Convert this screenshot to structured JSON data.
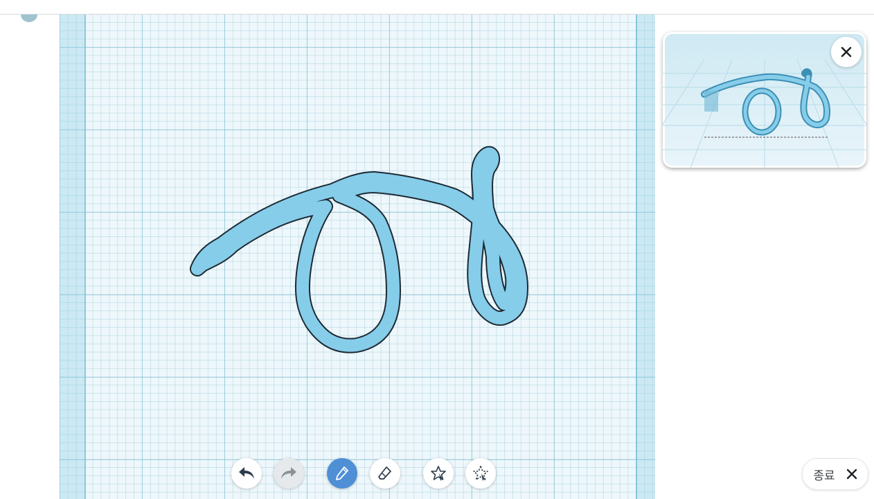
{
  "exit_button": {
    "label": "종료"
  },
  "colors": {
    "stroke_fill": "#86cde9",
    "stroke_outline": "#1c2a35",
    "active_tool": "#4e8fd6",
    "canvas_bg": "#eef7fb"
  },
  "toolbar": {
    "tools": [
      {
        "name": "undo",
        "icon": "undo-icon",
        "state": "enabled"
      },
      {
        "name": "redo",
        "icon": "redo-icon",
        "state": "disabled"
      },
      {
        "name": "pencil",
        "icon": "pencil-icon",
        "state": "active"
      },
      {
        "name": "eraser",
        "icon": "eraser-icon",
        "state": "enabled"
      },
      {
        "name": "shape-select",
        "icon": "star-lasso-icon",
        "state": "enabled"
      },
      {
        "name": "shape-erase",
        "icon": "star-lasso-dashed-icon",
        "state": "enabled"
      }
    ]
  },
  "preview": {
    "icon": "3d-extrusion-preview"
  },
  "close_icon": "close-icon"
}
